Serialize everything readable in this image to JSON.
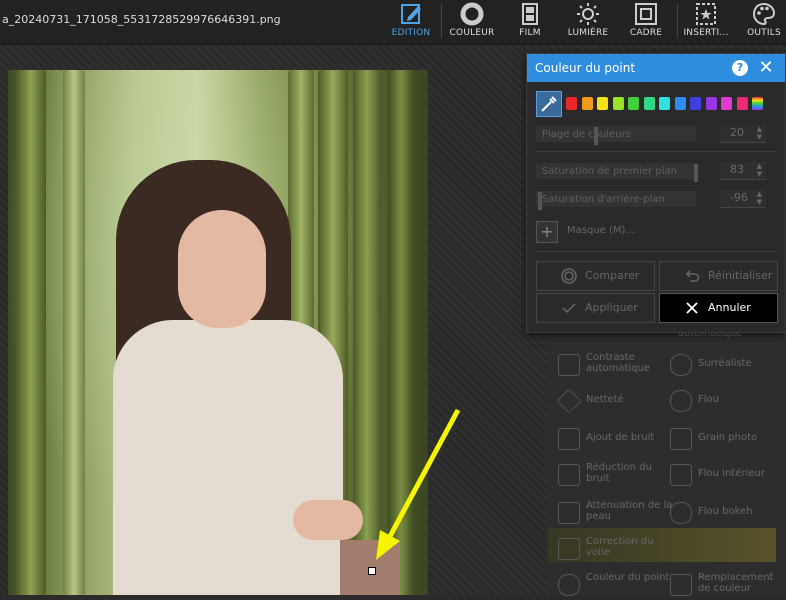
{
  "header": {
    "filename": "a_20240731_171058_5531728529976646391.png",
    "tools": [
      {
        "label": "EDITION",
        "icon": "edit-icon",
        "active": true
      },
      {
        "label": "COULEUR",
        "icon": "color-ring-icon",
        "active": false
      },
      {
        "label": "FILM",
        "icon": "film-icon",
        "active": false
      },
      {
        "label": "LUMIÈRE",
        "icon": "sun-icon",
        "active": false
      },
      {
        "label": "CADRE",
        "icon": "frame-icon",
        "active": false
      },
      {
        "label": "INSERTI...",
        "icon": "insert-icon",
        "active": false
      },
      {
        "label": "OUTILS",
        "icon": "palette-icon",
        "active": false
      }
    ]
  },
  "dialog": {
    "title": "Couleur du point",
    "help": "?",
    "close": "✕",
    "colors": [
      "#e8262b",
      "#f39a1c",
      "#f5e21a",
      "#9be22a",
      "#43d13b",
      "#2fd985",
      "#31e0e0",
      "#2c8ef2",
      "#3f3fe0",
      "#9a35e6",
      "#e13ad1",
      "#ee2a78",
      "rainbow"
    ],
    "sliders": [
      {
        "label": "Plage de couleurs",
        "value": "20"
      },
      {
        "label": "Saturation de premier plan",
        "value": "83"
      },
      {
        "label": "Saturation d'arrière-plan",
        "value": "-96"
      }
    ],
    "mask_label": "Masque (M)...",
    "buttons": {
      "compare": "Comparer",
      "reset": "Réinitialiser",
      "apply": "Appliquer",
      "cancel": "Annuler"
    }
  },
  "tools_panel": {
    "items": [
      {
        "label": "automatique"
      },
      {
        "label": "Contraste automatique"
      },
      {
        "label": "Surréaliste"
      },
      {
        "label": "Netteté"
      },
      {
        "label": "Flou"
      },
      {
        "label": "Ajout de bruit"
      },
      {
        "label": "Grain photo"
      },
      {
        "label": "Réduction du bruit"
      },
      {
        "label": "Flou intérieur"
      },
      {
        "label": "Atténuation de la peau"
      },
      {
        "label": "Flou bokeh"
      },
      {
        "label": "Correction du voile"
      },
      {
        "label": "Couleur du point"
      },
      {
        "label": "Remplacement de couleur"
      }
    ]
  },
  "colors": {
    "accent": "#2f8ddf",
    "arrow": "#f5f500",
    "sample": "#a27d6e"
  }
}
